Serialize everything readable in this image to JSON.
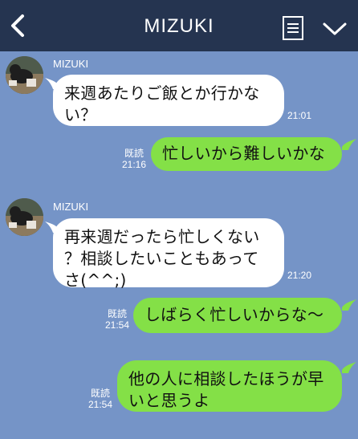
{
  "header": {
    "contact_name": "MIZUKI"
  },
  "messages": [
    {
      "direction": "incoming",
      "sender": "MIZUKI",
      "text": "来週あたりご飯とか行かな\nい？",
      "time": "21:01"
    },
    {
      "direction": "outgoing",
      "read_label": "既読",
      "text": "忙しいから難しいかな",
      "time": "21:16"
    },
    {
      "direction": "incoming",
      "sender": "MIZUKI",
      "text": "再来週だったら忙しくない\n？相談したいこともあって\nさ(^^;)",
      "time": "21:20"
    },
    {
      "direction": "outgoing",
      "read_label": "既読",
      "text": "しばらく忙しいからな～",
      "time": "21:54"
    },
    {
      "direction": "outgoing",
      "read_label": "既読",
      "text": "他の人に相談したほうが早\nいと思うよ",
      "time": "21:54"
    }
  ],
  "colors": {
    "header_bg": "#253450",
    "chat_bg": "#7594c7",
    "incoming_bubble": "#ffffff",
    "outgoing_bubble": "#84e047"
  },
  "icons": {
    "back": "chevron-left-icon",
    "notes": "notes-icon",
    "menu": "chevron-down-icon"
  }
}
